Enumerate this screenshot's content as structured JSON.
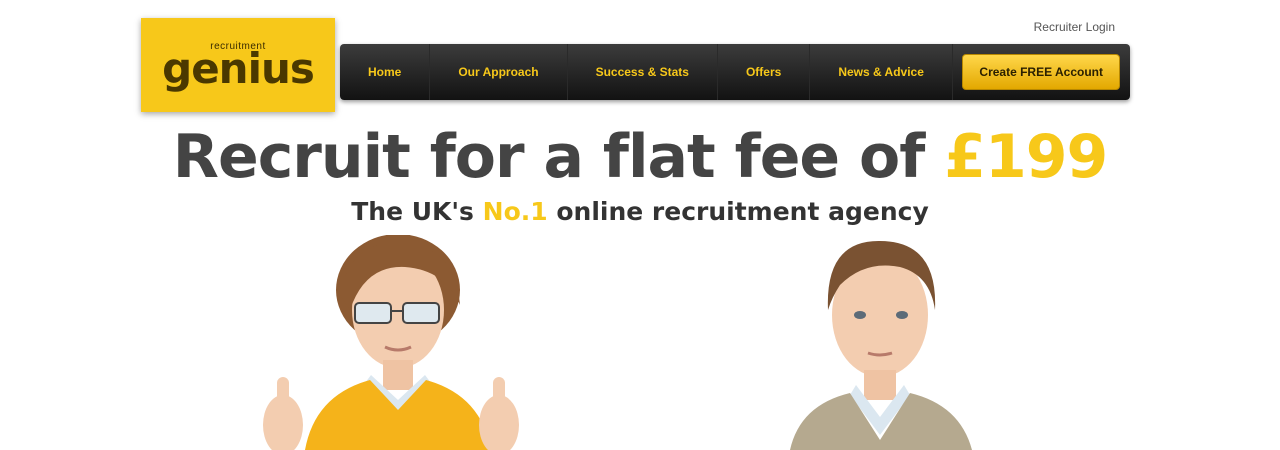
{
  "logo": {
    "small_text": "recruitment",
    "big_text": "genius"
  },
  "header": {
    "login_link": "Recruiter Login"
  },
  "nav": {
    "items": [
      {
        "label": "Home"
      },
      {
        "label": "Our Approach"
      },
      {
        "label": "Success & Stats"
      },
      {
        "label": "Offers"
      },
      {
        "label": "News & Advice"
      }
    ],
    "cta_label": "Create FREE Account"
  },
  "hero": {
    "headline_prefix": "Recruit for a flat fee of ",
    "headline_price": "£199",
    "sub_prefix": "The UK's ",
    "sub_highlight": "No.1",
    "sub_suffix": " online recruitment agency"
  },
  "colors": {
    "brand_yellow": "#f7c81a",
    "nav_dark": "#1c1c1c",
    "headline_grey": "#444444"
  }
}
